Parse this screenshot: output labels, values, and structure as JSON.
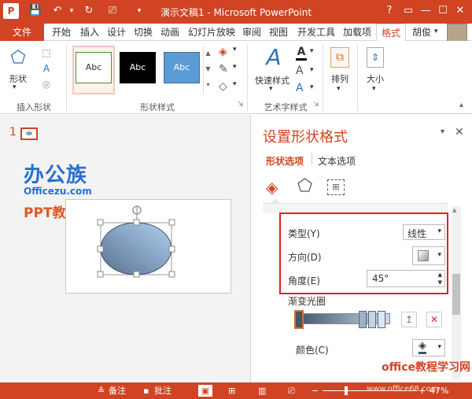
{
  "titlebar": {
    "title": "演示文稿1 - Microsoft PowerPoint",
    "app_icon": "P",
    "help": "?",
    "restore": "▭",
    "minimize": "—",
    "maximize": "☐",
    "close": "✕"
  },
  "tabs": {
    "file": "文件",
    "items": [
      "开始",
      "插入",
      "设计",
      "切换",
      "动画",
      "幻灯片放映",
      "审阅",
      "视图",
      "开发工具",
      "加载项",
      "格式"
    ],
    "user": "胡俊"
  },
  "ribbon": {
    "insert_shapes": {
      "shape_label": "形状",
      "group_label": "插入形状"
    },
    "shape_styles": {
      "samples": [
        "Abc",
        "Abc",
        "Abc"
      ],
      "group_label": "形状样式"
    },
    "wordart": {
      "quick_styles": "快速样式",
      "text_a": "A",
      "group_label": "艺术字样式"
    },
    "arrange": {
      "label": "排列"
    },
    "size": {
      "label": "大小"
    }
  },
  "slides": {
    "number": "1"
  },
  "watermark_top": {
    "line1": "办公族",
    "line2": "Officezu.com",
    "line3": "PPT教程"
  },
  "format_pane": {
    "title": "设置形状格式",
    "tab_shape": "形状选项",
    "tab_text": "文本选项",
    "type_label": "类型(Y)",
    "type_value": "线性",
    "direction_label": "方向(D)",
    "angle_label": "角度(E)",
    "angle_value": "45°",
    "gradient_stops_label": "渐变光圈",
    "color_label": "颜色(C)"
  },
  "statusbar": {
    "notes": "备注",
    "comments": "批注",
    "zoom_value": "47%"
  },
  "watermark_bottom": {
    "line1": "office教程学习网",
    "line2": "www.office68.com"
  },
  "colors": {
    "accent": "#d04423",
    "highlight_box": "#e0211d",
    "ellipse_light": "#aed1f0",
    "ellipse_dark": "#5a7090"
  }
}
